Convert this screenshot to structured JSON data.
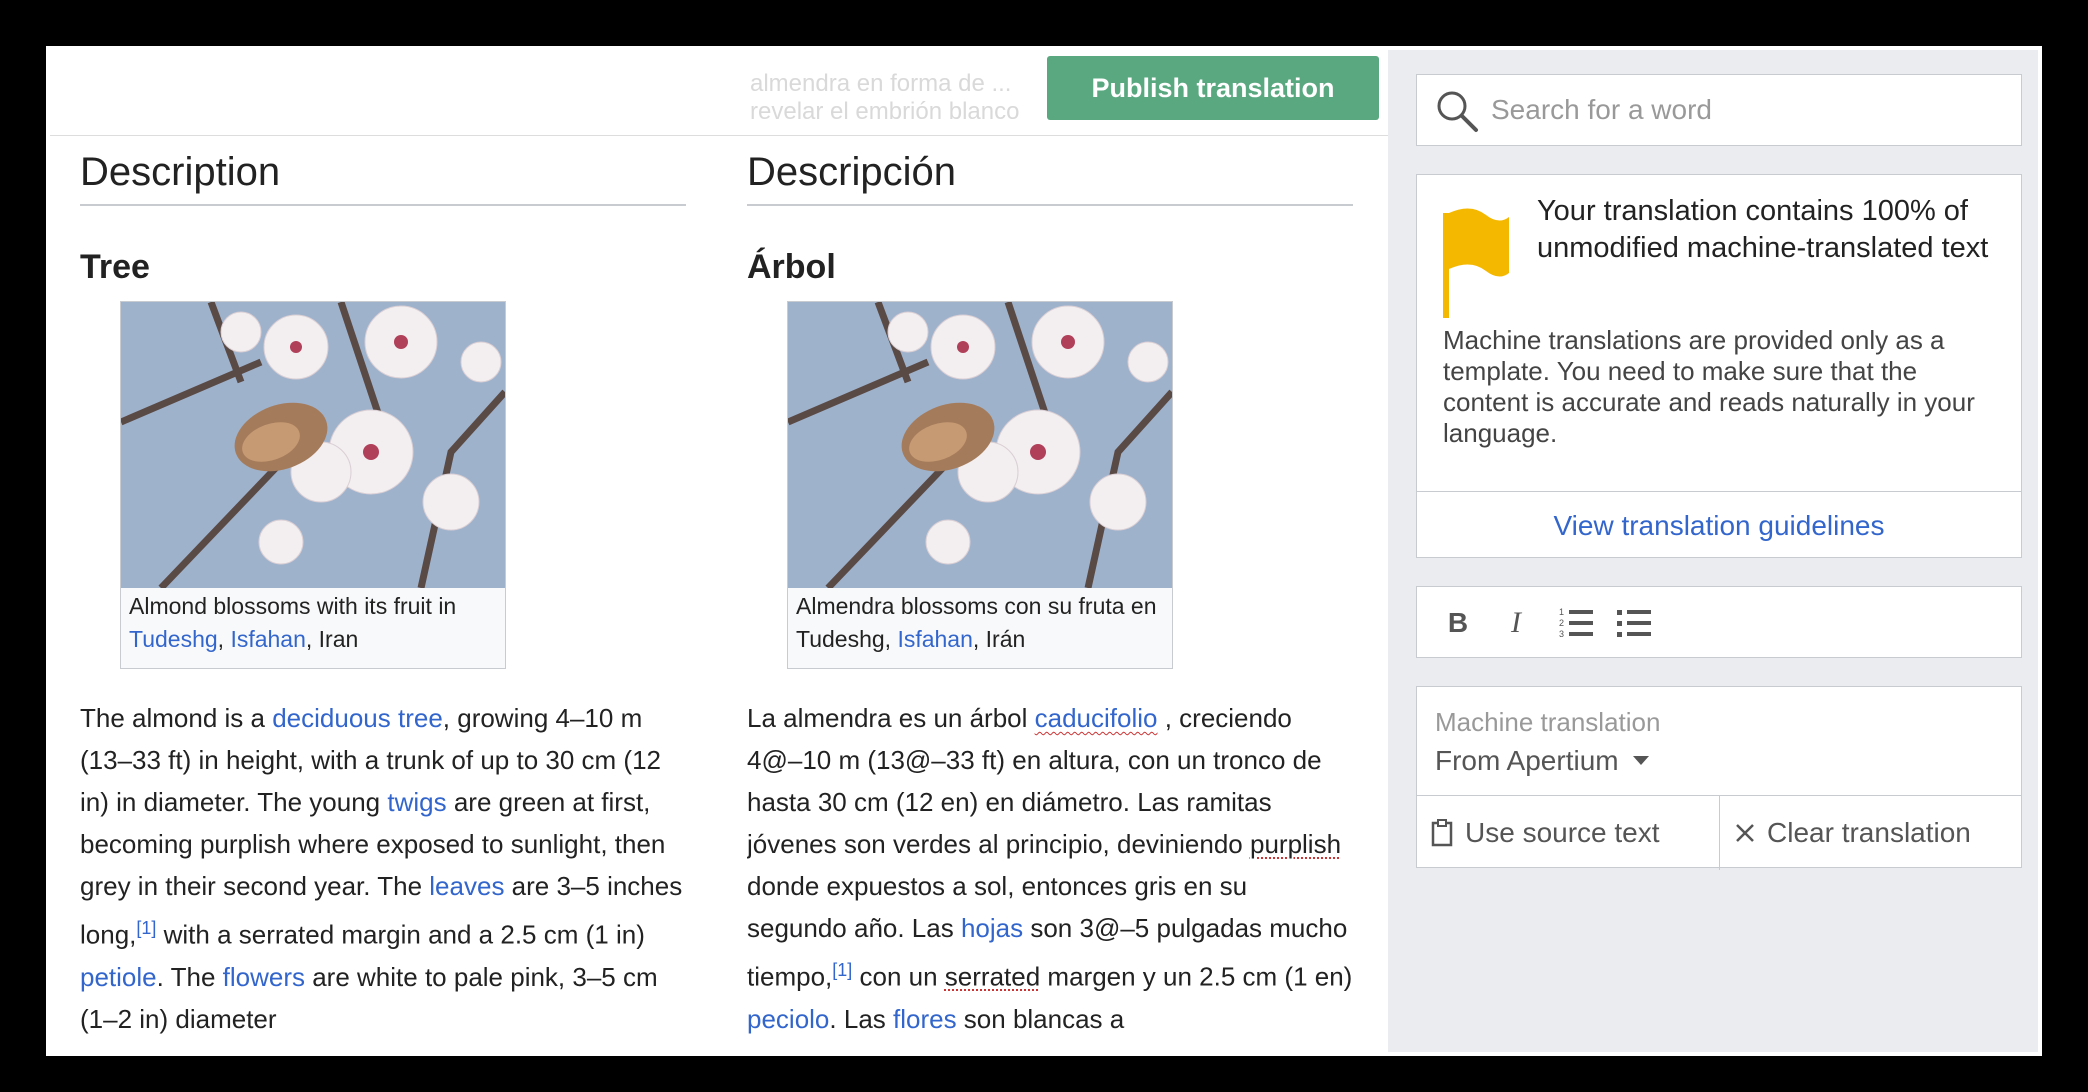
{
  "topbar": {
    "ghost_text_line1": "almendra en forma de ...",
    "ghost_text_line2": "revelar el embrión blanco",
    "publish_label": "Publish translation"
  },
  "source": {
    "section_title": "Description",
    "subheading": "Tree",
    "caption_prefix": "Almond blossoms with its fruit in ",
    "caption_link1": "Tudeshg",
    "caption_sep": ", ",
    "caption_link2": "Isfahan",
    "caption_suffix": ", Iran",
    "p1": "The almond is a ",
    "link_deciduous": "deciduous tree",
    "p2": ", growing 4–10 m (13–33 ft) in height, with a trunk of up to 30 cm (12 in) in diameter. The young ",
    "link_twigs": "twigs",
    "p3": " are green at first, becoming purplish where exposed to sunlight, then grey in their second year. The ",
    "link_leaves": "leaves",
    "p4": " are 3–5 inches long,",
    "ref": "[1]",
    "p5": " with a serrated margin and a 2.5 cm (1 in) ",
    "link_petiole": "petiole",
    "p6": ". The ",
    "link_flowers": "flowers",
    "p7": " are white to pale pink, 3–5 cm (1–2 in) diameter"
  },
  "target": {
    "section_title": "Descripción",
    "subheading": "Árbol",
    "caption_prefix": "Almendra blossoms con su fruta en Tudeshg, ",
    "caption_link": "Isfahan",
    "caption_suffix": ", Irán",
    "p1": "La almendra es un árbol ",
    "link_caducifolio": "caducifolio",
    "p2": " , creciendo 4@–10 m (13@–33 ft) en altura, con un tronco de hasta 30 cm (12 en) en diámetro. Las ramitas jóvenes son verdes al principio, deviniendo ",
    "word_purplish": "purplish",
    "p3": " donde expuestos a sol, entonces gris en su segundo año. Las ",
    "link_hojas": "hojas",
    "p4": " son 3@–5 pulgadas mucho tiempo,",
    "ref": "[1]",
    "p5": " con un ",
    "word_serrated": "serrated",
    "p6": " margen y un 2.5 cm (1 en) ",
    "link_peciolo": "peciolo",
    "p7": ". Las ",
    "link_flores": "flores",
    "p8": " son blancas a"
  },
  "sidebar": {
    "search_placeholder": "Search for a word",
    "warning_title": "Your translation contains 100% of unmodified machine-translated text",
    "warning_body": "Machine translations are provided only as a template. You need to make sure that the content is accurate and reads naturally in your language.",
    "guidelines_link": "View translation guidelines",
    "toolbar": {
      "bold": "B",
      "italic": "I"
    },
    "mt_label": "Machine translation",
    "mt_provider": "From Apertium",
    "use_source": "Use source text",
    "clear": "Clear translation"
  },
  "colors": {
    "publish_button": "#5aa880",
    "link": "#3366cc",
    "flag": "#f5b800",
    "panel_bg": "#eaecf0"
  },
  "icons": [
    "search-icon",
    "flag-icon",
    "bold-icon",
    "italic-icon",
    "numbered-list-icon",
    "bulleted-list-icon",
    "dropdown-arrow-icon",
    "clipboard-icon",
    "close-icon"
  ]
}
